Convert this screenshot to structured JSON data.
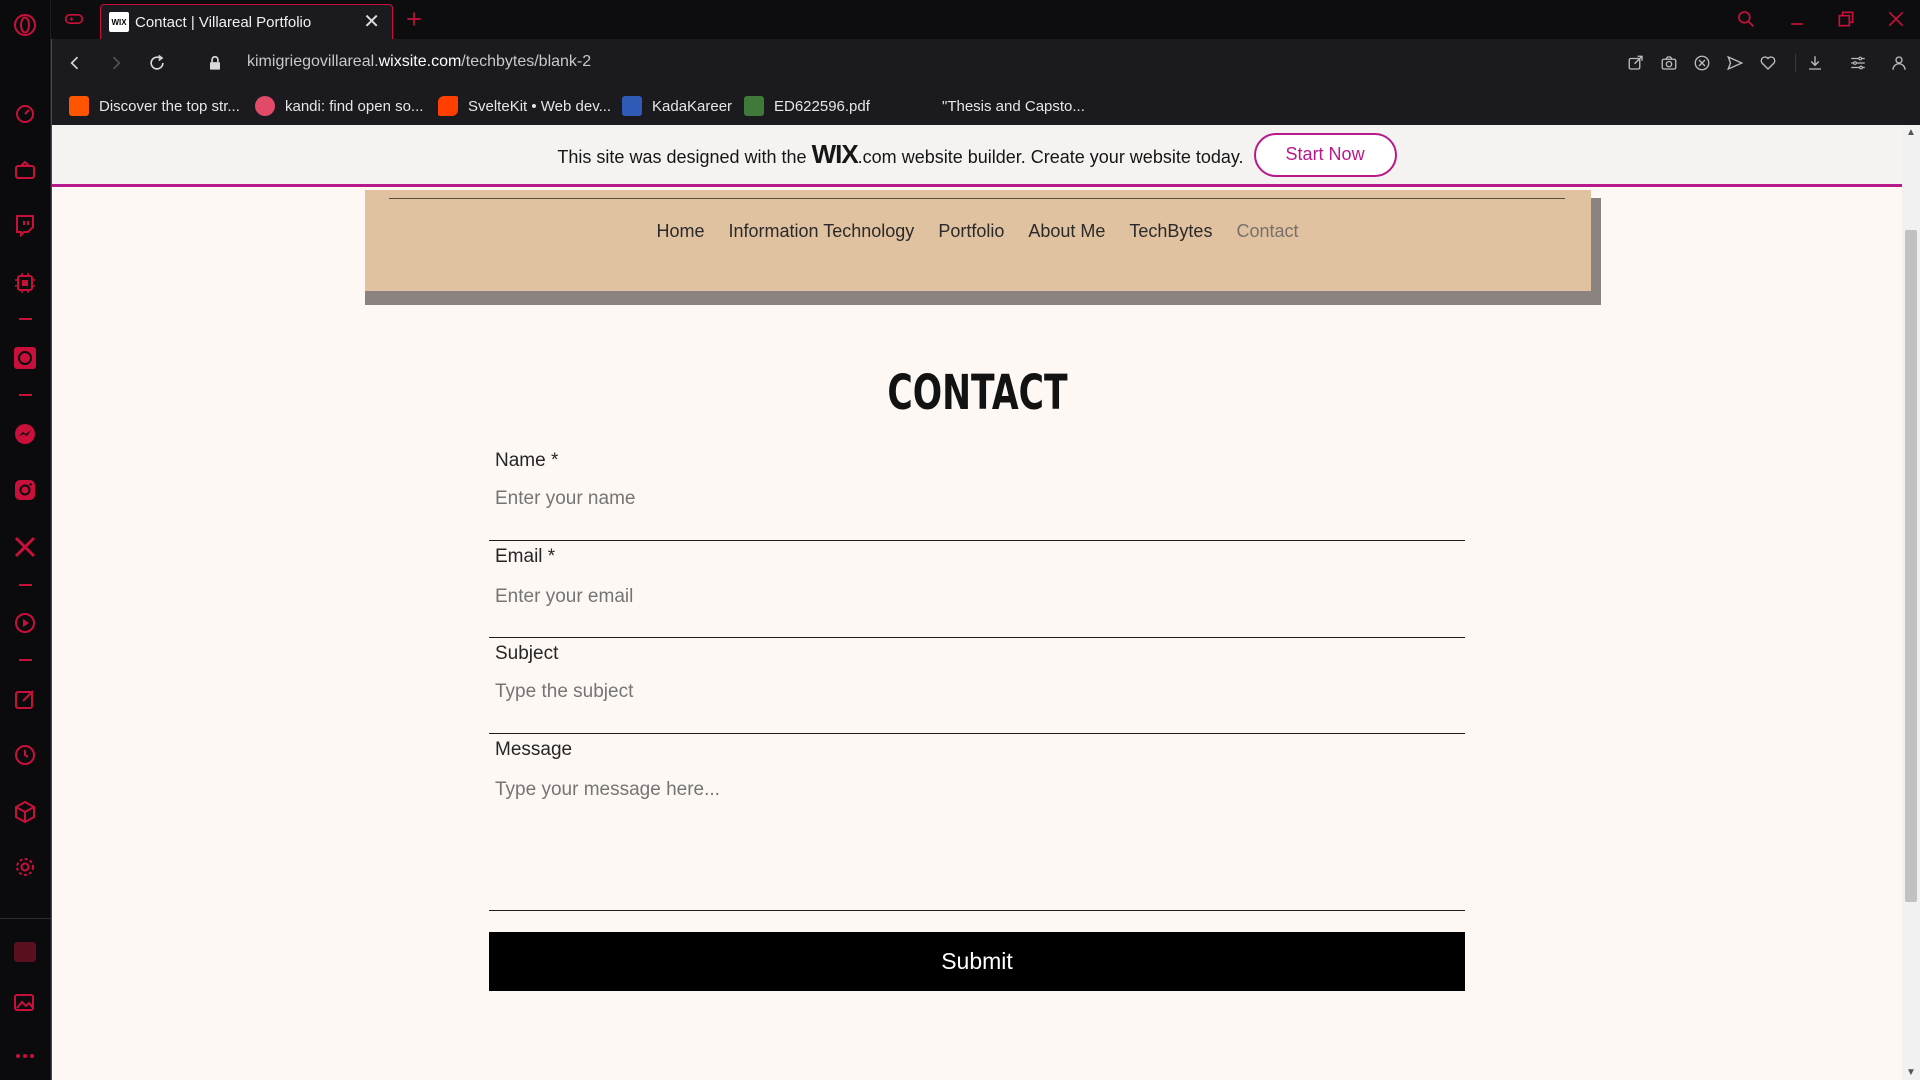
{
  "browser": {
    "tab_title": "Contact | Villareal Portfolio",
    "tab_favicon_text": "WIX",
    "url_prefix": "kimigriegovillareal.",
    "url_domain": "wixsite.com",
    "url_path": "/techbytes/blank-2",
    "accent_color": "#c8103b"
  },
  "bookmarks": [
    {
      "label": "Discover the top str...",
      "icon": "soundcloud-icon",
      "color": "#ff5500"
    },
    {
      "label": "kandi: find open so...",
      "icon": "kandi-icon",
      "color": "#e24a6a"
    },
    {
      "label": "SvelteKit • Web dev...",
      "icon": "svelte-icon",
      "color": "#ff3e00"
    },
    {
      "label": "KadaKareer",
      "icon": "kadakareer-icon",
      "color": "#2f5bb7"
    },
    {
      "label": "ED622596.pdf",
      "icon": "eric-icon",
      "color": "#3f7a3a"
    },
    {
      "label": "\"Thesis and Capsto...",
      "icon": "blank-page-icon",
      "color": "#1a1a1f"
    }
  ],
  "wix_banner": {
    "text_before": "This site was designed with the ",
    "logo": "WIX",
    "logo_suffix": ".com",
    "text_after": " website builder. Create your website today.",
    "button": "Start Now",
    "accent_color": "#b8198b"
  },
  "site_nav": {
    "items": [
      "Home",
      "Information Technology",
      "Portfolio",
      "About Me",
      "TechBytes",
      "Contact"
    ],
    "active": "Contact"
  },
  "contact": {
    "title": "CONTACT",
    "fields": [
      {
        "label": "Name *",
        "placeholder": "Enter your name"
      },
      {
        "label": "Email *",
        "placeholder": "Enter your email"
      },
      {
        "label": "Subject",
        "placeholder": "Type the subject"
      },
      {
        "label": "Message",
        "placeholder": "Type your message here..."
      }
    ],
    "submit": "Submit"
  }
}
